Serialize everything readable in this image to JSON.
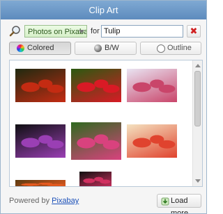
{
  "window": {
    "title": "Clip Art"
  },
  "search": {
    "icon": "magnifier-icon",
    "source_selected": "Photos on Pixabay",
    "for_label": "for",
    "query_value": "Tulip",
    "clear_icon": "close-x-icon"
  },
  "filters": [
    {
      "label": "Colored",
      "icon": "color-wheel-icon",
      "selected": true
    },
    {
      "label": "B/W",
      "icon": "bw-circle-icon",
      "selected": false
    },
    {
      "label": "Outline",
      "icon": "outline-circle-icon",
      "selected": false
    }
  ],
  "results": {
    "thumbnails": [
      {
        "name": "red-tulips-photo",
        "colors": [
          "#1f2a10",
          "#c42b12"
        ]
      },
      {
        "name": "red-tulip-closeup-photo",
        "colors": [
          "#2a5a10",
          "#d91a25"
        ]
      },
      {
        "name": "mixed-tulips-photo",
        "colors": [
          "#e9e4f2",
          "#c9456a"
        ]
      },
      {
        "name": "purple-tulip-photo",
        "colors": [
          "#0f0f12",
          "#9a3fb4"
        ]
      },
      {
        "name": "pink-tulip-field-photo",
        "colors": [
          "#2f6a1f",
          "#d9427e"
        ]
      },
      {
        "name": "tulip-field-colorful-photo",
        "colors": [
          "#f4e2c0",
          "#e0432e"
        ]
      },
      {
        "name": "tulip-partial-1",
        "colors": [
          "#5a3a10",
          "#e55a20"
        ]
      },
      {
        "name": "tulip-partial-2",
        "colors": [
          "#101010",
          "#d03060"
        ]
      }
    ]
  },
  "footer": {
    "powered_by": "Powered by",
    "provider_link": "Pixabay",
    "load_more_label": "Load more",
    "load_more_icon": "download-arrow-icon"
  }
}
